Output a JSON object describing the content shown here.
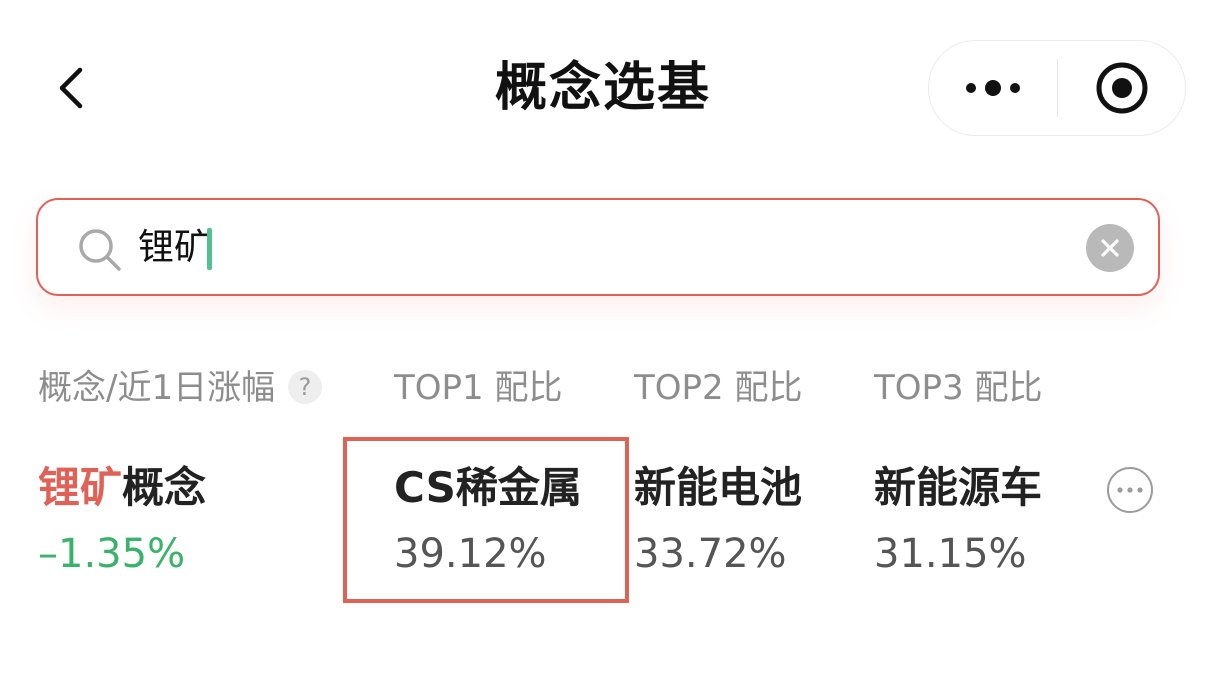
{
  "header": {
    "title": "概念选基",
    "back_icon": "chevron-left-icon",
    "more_icon": "ellipsis-icon",
    "close_icon": "target-circle-icon"
  },
  "search": {
    "value": "锂矿",
    "search_icon": "search-icon",
    "clear_icon": "clear-icon",
    "border_color": "#e06155",
    "caret_color": "#53c192"
  },
  "table": {
    "columns": [
      "概念/近1日涨幅",
      "TOP1 配比",
      "TOP2 配比",
      "TOP3 配比"
    ],
    "help_label": "?",
    "rows": [
      {
        "concept_highlight": "锂矿",
        "concept_rest": "概念",
        "change": "–1.35%",
        "top": [
          {
            "name": "CS稀金属",
            "ratio": "39.12%"
          },
          {
            "name": "新能电池",
            "ratio": "33.72%"
          },
          {
            "name": "新能源车",
            "ratio": "31.15%"
          }
        ],
        "more_icon": "more-circle-icon"
      }
    ]
  },
  "colors": {
    "accent_red": "#e06155",
    "down_green": "#3ab36a",
    "muted_gray": "#8d8d8d"
  }
}
